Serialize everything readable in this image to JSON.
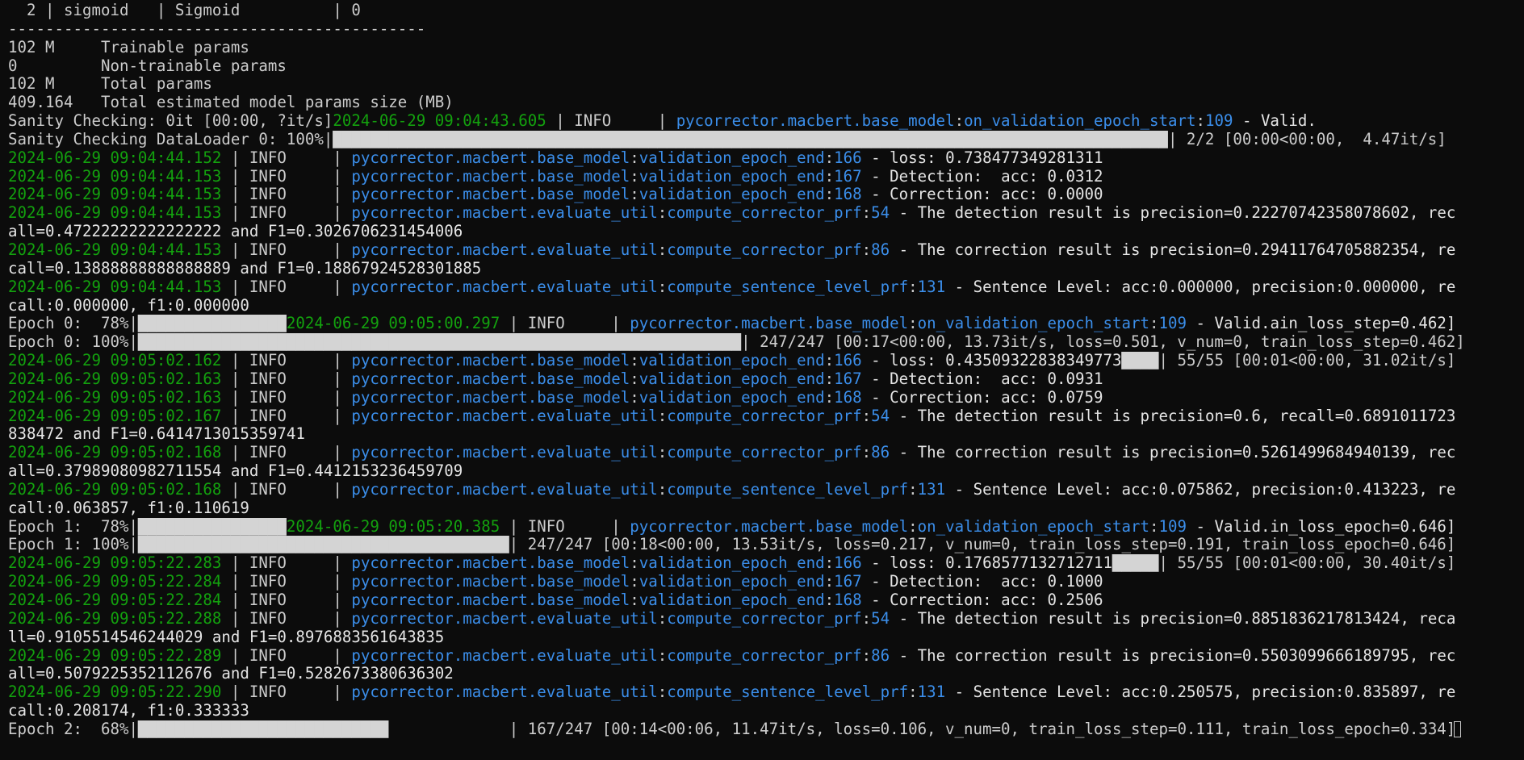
{
  "window": {
    "app": "terminal",
    "colors": {
      "background": "#0c0c0c",
      "text": "#cccccc",
      "timestamp": "#13a10e",
      "module_path": "#3b8eea"
    }
  },
  "lines": [
    [
      {
        "t": "  2 | sigmoid   | Sigmoid          | 0",
        "c": "default"
      }
    ],
    [
      {
        "t": "---------------------------------------------",
        "c": "default"
      }
    ],
    [
      {
        "t": "102 M     Trainable params",
        "c": "default"
      }
    ],
    [
      {
        "t": "0         Non-trainable params",
        "c": "default"
      }
    ],
    [
      {
        "t": "102 M     Total params",
        "c": "default"
      }
    ],
    [
      {
        "t": "409.164   Total estimated model params size (MB)",
        "c": "default"
      }
    ],
    [
      {
        "t": "Sanity Checking: 0it [00:00, ?it/s]",
        "c": "default"
      },
      {
        "t": "2024-06-29 09:04:43.605",
        "c": "green"
      },
      {
        "t": " | INFO     | ",
        "c": "default"
      },
      {
        "t": "pycorrector.macbert.base_model",
        "c": "blue"
      },
      {
        "t": ":",
        "c": "default"
      },
      {
        "t": "on_validation_epoch_start",
        "c": "blue"
      },
      {
        "t": ":",
        "c": "default"
      },
      {
        "t": "109",
        "c": "blue"
      },
      {
        "t": " - Valid.",
        "c": "white"
      }
    ],
    [
      {
        "t": "Sanity Checking DataLoader 0: 100%|",
        "c": "default"
      },
      {
        "t": "██████████████████████████████████████████████████████████████████████████████████████████",
        "c": "bar"
      },
      {
        "t": "| 2/2 [00:00<00:00,  4.47it/s]",
        "c": "default"
      }
    ],
    [
      {
        "t": "2024-06-29 09:04:44.152",
        "c": "green"
      },
      {
        "t": " | INFO     | ",
        "c": "default"
      },
      {
        "t": "pycorrector.macbert.base_model",
        "c": "blue"
      },
      {
        "t": ":",
        "c": "default"
      },
      {
        "t": "validation_epoch_end",
        "c": "blue"
      },
      {
        "t": ":",
        "c": "default"
      },
      {
        "t": "166",
        "c": "blue"
      },
      {
        "t": " - loss: 0.738477349281311",
        "c": "white"
      }
    ],
    [
      {
        "t": "2024-06-29 09:04:44.153",
        "c": "green"
      },
      {
        "t": " | INFO     | ",
        "c": "default"
      },
      {
        "t": "pycorrector.macbert.base_model",
        "c": "blue"
      },
      {
        "t": ":",
        "c": "default"
      },
      {
        "t": "validation_epoch_end",
        "c": "blue"
      },
      {
        "t": ":",
        "c": "default"
      },
      {
        "t": "167",
        "c": "blue"
      },
      {
        "t": " - Detection:  acc: 0.0312",
        "c": "white"
      }
    ],
    [
      {
        "t": "2024-06-29 09:04:44.153",
        "c": "green"
      },
      {
        "t": " | INFO     | ",
        "c": "default"
      },
      {
        "t": "pycorrector.macbert.base_model",
        "c": "blue"
      },
      {
        "t": ":",
        "c": "default"
      },
      {
        "t": "validation_epoch_end",
        "c": "blue"
      },
      {
        "t": ":",
        "c": "default"
      },
      {
        "t": "168",
        "c": "blue"
      },
      {
        "t": " - Correction: acc: 0.0000",
        "c": "white"
      }
    ],
    [
      {
        "t": "2024-06-29 09:04:44.153",
        "c": "green"
      },
      {
        "t": " | INFO     | ",
        "c": "default"
      },
      {
        "t": "pycorrector.macbert.evaluate_util",
        "c": "blue"
      },
      {
        "t": ":",
        "c": "default"
      },
      {
        "t": "compute_corrector_prf",
        "c": "blue"
      },
      {
        "t": ":",
        "c": "default"
      },
      {
        "t": "54",
        "c": "blue"
      },
      {
        "t": " - The detection result is precision=0.22270742358078602, rec",
        "c": "white"
      }
    ],
    [
      {
        "t": "all=0.47222222222222222 and F1=0.3026706231454006",
        "c": "white"
      }
    ],
    [
      {
        "t": "2024-06-29 09:04:44.153",
        "c": "green"
      },
      {
        "t": " | INFO     | ",
        "c": "default"
      },
      {
        "t": "pycorrector.macbert.evaluate_util",
        "c": "blue"
      },
      {
        "t": ":",
        "c": "default"
      },
      {
        "t": "compute_corrector_prf",
        "c": "blue"
      },
      {
        "t": ":",
        "c": "default"
      },
      {
        "t": "86",
        "c": "blue"
      },
      {
        "t": " - The correction result is precision=0.29411764705882354, re",
        "c": "white"
      }
    ],
    [
      {
        "t": "call=0.13888888888888889 and F1=0.18867924528301885",
        "c": "white"
      }
    ],
    [
      {
        "t": "2024-06-29 09:04:44.153",
        "c": "green"
      },
      {
        "t": " | INFO     | ",
        "c": "default"
      },
      {
        "t": "pycorrector.macbert.evaluate_util",
        "c": "blue"
      },
      {
        "t": ":",
        "c": "default"
      },
      {
        "t": "compute_sentence_level_prf",
        "c": "blue"
      },
      {
        "t": ":",
        "c": "default"
      },
      {
        "t": "131",
        "c": "blue"
      },
      {
        "t": " - Sentence Level: acc:0.000000, precision:0.000000, re",
        "c": "white"
      }
    ],
    [
      {
        "t": "call:0.000000, f1:0.000000",
        "c": "white"
      }
    ],
    [
      {
        "t": "Epoch 0:  78%|",
        "c": "default"
      },
      {
        "t": "████████████████",
        "c": "bar"
      },
      {
        "t": "2024-06-29 09:05:00.297",
        "c": "green"
      },
      {
        "t": " | INFO     | ",
        "c": "default"
      },
      {
        "t": "pycorrector.macbert.base_model",
        "c": "blue"
      },
      {
        "t": ":",
        "c": "default"
      },
      {
        "t": "on_validation_epoch_start",
        "c": "blue"
      },
      {
        "t": ":",
        "c": "default"
      },
      {
        "t": "109",
        "c": "blue"
      },
      {
        "t": " - Valid.ain_loss_step=0.462]",
        "c": "white"
      }
    ],
    [
      {
        "t": "Epoch 0: 100%|",
        "c": "default"
      },
      {
        "t": "█████████████████████████████████████████████████████████████████",
        "c": "bar"
      },
      {
        "t": "| 247/247 [00:17<00:00, 13.73it/s, loss=0.501, v_num=0, train_loss_step=0.462]",
        "c": "default"
      }
    ],
    [
      {
        "t": "2024-06-29 09:05:02.162",
        "c": "green"
      },
      {
        "t": " | INFO     | ",
        "c": "default"
      },
      {
        "t": "pycorrector.macbert.base_model",
        "c": "blue"
      },
      {
        "t": ":",
        "c": "default"
      },
      {
        "t": "validation_epoch_end",
        "c": "blue"
      },
      {
        "t": ":",
        "c": "default"
      },
      {
        "t": "166",
        "c": "blue"
      },
      {
        "t": " - loss: 0.43509322838349773",
        "c": "white"
      },
      {
        "t": "████",
        "c": "bar"
      },
      {
        "t": "| 55/55 [00:01<00:00, 31.02it/s]",
        "c": "default"
      }
    ],
    [
      {
        "t": "2024-06-29 09:05:02.163",
        "c": "green"
      },
      {
        "t": " | INFO     | ",
        "c": "default"
      },
      {
        "t": "pycorrector.macbert.base_model",
        "c": "blue"
      },
      {
        "t": ":",
        "c": "default"
      },
      {
        "t": "validation_epoch_end",
        "c": "blue"
      },
      {
        "t": ":",
        "c": "default"
      },
      {
        "t": "167",
        "c": "blue"
      },
      {
        "t": " - Detection:  acc: 0.0931",
        "c": "white"
      }
    ],
    [
      {
        "t": "2024-06-29 09:05:02.163",
        "c": "green"
      },
      {
        "t": " | INFO     | ",
        "c": "default"
      },
      {
        "t": "pycorrector.macbert.base_model",
        "c": "blue"
      },
      {
        "t": ":",
        "c": "default"
      },
      {
        "t": "validation_epoch_end",
        "c": "blue"
      },
      {
        "t": ":",
        "c": "default"
      },
      {
        "t": "168",
        "c": "blue"
      },
      {
        "t": " - Correction: acc: 0.0759",
        "c": "white"
      }
    ],
    [
      {
        "t": "2024-06-29 09:05:02.167",
        "c": "green"
      },
      {
        "t": " | INFO     | ",
        "c": "default"
      },
      {
        "t": "pycorrector.macbert.evaluate_util",
        "c": "blue"
      },
      {
        "t": ":",
        "c": "default"
      },
      {
        "t": "compute_corrector_prf",
        "c": "blue"
      },
      {
        "t": ":",
        "c": "default"
      },
      {
        "t": "54",
        "c": "blue"
      },
      {
        "t": " - The detection result is precision=0.6, recall=0.6891011723",
        "c": "white"
      }
    ],
    [
      {
        "t": "838472 and F1=0.6414713015359741",
        "c": "white"
      }
    ],
    [
      {
        "t": "2024-06-29 09:05:02.168",
        "c": "green"
      },
      {
        "t": " | INFO     | ",
        "c": "default"
      },
      {
        "t": "pycorrector.macbert.evaluate_util",
        "c": "blue"
      },
      {
        "t": ":",
        "c": "default"
      },
      {
        "t": "compute_corrector_prf",
        "c": "blue"
      },
      {
        "t": ":",
        "c": "default"
      },
      {
        "t": "86",
        "c": "blue"
      },
      {
        "t": " - The correction result is precision=0.5261499684940139, rec",
        "c": "white"
      }
    ],
    [
      {
        "t": "all=0.37989080982711554 and F1=0.4412153236459709",
        "c": "white"
      }
    ],
    [
      {
        "t": "2024-06-29 09:05:02.168",
        "c": "green"
      },
      {
        "t": " | INFO     | ",
        "c": "default"
      },
      {
        "t": "pycorrector.macbert.evaluate_util",
        "c": "blue"
      },
      {
        "t": ":",
        "c": "default"
      },
      {
        "t": "compute_sentence_level_prf",
        "c": "blue"
      },
      {
        "t": ":",
        "c": "default"
      },
      {
        "t": "131",
        "c": "blue"
      },
      {
        "t": " - Sentence Level: acc:0.075862, precision:0.413223, re",
        "c": "white"
      }
    ],
    [
      {
        "t": "call:0.063857, f1:0.110619",
        "c": "white"
      }
    ],
    [
      {
        "t": "Epoch 1:  78%|",
        "c": "default"
      },
      {
        "t": "████████████████",
        "c": "bar"
      },
      {
        "t": "2024-06-29 09:05:20.385",
        "c": "green"
      },
      {
        "t": " | INFO     | ",
        "c": "default"
      },
      {
        "t": "pycorrector.macbert.base_model",
        "c": "blue"
      },
      {
        "t": ":",
        "c": "default"
      },
      {
        "t": "on_validation_epoch_start",
        "c": "blue"
      },
      {
        "t": ":",
        "c": "default"
      },
      {
        "t": "109",
        "c": "blue"
      },
      {
        "t": " - Valid.in_loss_epoch=0.646]",
        "c": "white"
      }
    ],
    [
      {
        "t": "Epoch 1: 100%|",
        "c": "default"
      },
      {
        "t": "████████████████████████████████████████",
        "c": "bar"
      },
      {
        "t": "| 247/247 [00:18<00:00, 13.53it/s, loss=0.217, v_num=0, train_loss_step=0.191, train_loss_epoch=0.646]",
        "c": "default"
      }
    ],
    [
      {
        "t": "2024-06-29 09:05:22.283",
        "c": "green"
      },
      {
        "t": " | INFO     | ",
        "c": "default"
      },
      {
        "t": "pycorrector.macbert.base_model",
        "c": "blue"
      },
      {
        "t": ":",
        "c": "default"
      },
      {
        "t": "validation_epoch_end",
        "c": "blue"
      },
      {
        "t": ":",
        "c": "default"
      },
      {
        "t": "166",
        "c": "blue"
      },
      {
        "t": " - loss: 0.1768577132712711",
        "c": "white"
      },
      {
        "t": "█████",
        "c": "bar"
      },
      {
        "t": "| 55/55 [00:01<00:00, 30.40it/s]",
        "c": "default"
      }
    ],
    [
      {
        "t": "2024-06-29 09:05:22.284",
        "c": "green"
      },
      {
        "t": " | INFO     | ",
        "c": "default"
      },
      {
        "t": "pycorrector.macbert.base_model",
        "c": "blue"
      },
      {
        "t": ":",
        "c": "default"
      },
      {
        "t": "validation_epoch_end",
        "c": "blue"
      },
      {
        "t": ":",
        "c": "default"
      },
      {
        "t": "167",
        "c": "blue"
      },
      {
        "t": " - Detection:  acc: 0.1000",
        "c": "white"
      }
    ],
    [
      {
        "t": "2024-06-29 09:05:22.284",
        "c": "green"
      },
      {
        "t": " | INFO     | ",
        "c": "default"
      },
      {
        "t": "pycorrector.macbert.base_model",
        "c": "blue"
      },
      {
        "t": ":",
        "c": "default"
      },
      {
        "t": "validation_epoch_end",
        "c": "blue"
      },
      {
        "t": ":",
        "c": "default"
      },
      {
        "t": "168",
        "c": "blue"
      },
      {
        "t": " - Correction: acc: 0.2506",
        "c": "white"
      }
    ],
    [
      {
        "t": "2024-06-29 09:05:22.288",
        "c": "green"
      },
      {
        "t": " | INFO     | ",
        "c": "default"
      },
      {
        "t": "pycorrector.macbert.evaluate_util",
        "c": "blue"
      },
      {
        "t": ":",
        "c": "default"
      },
      {
        "t": "compute_corrector_prf",
        "c": "blue"
      },
      {
        "t": ":",
        "c": "default"
      },
      {
        "t": "54",
        "c": "blue"
      },
      {
        "t": " - The detection result is precision=0.8851836217813424, reca",
        "c": "white"
      }
    ],
    [
      {
        "t": "ll=0.9105514546244029 and F1=0.8976883561643835",
        "c": "white"
      }
    ],
    [
      {
        "t": "2024-06-29 09:05:22.289",
        "c": "green"
      },
      {
        "t": " | INFO     | ",
        "c": "default"
      },
      {
        "t": "pycorrector.macbert.evaluate_util",
        "c": "blue"
      },
      {
        "t": ":",
        "c": "default"
      },
      {
        "t": "compute_corrector_prf",
        "c": "blue"
      },
      {
        "t": ":",
        "c": "default"
      },
      {
        "t": "86",
        "c": "blue"
      },
      {
        "t": " - The correction result is precision=0.5503099666189795, rec",
        "c": "white"
      }
    ],
    [
      {
        "t": "all=0.5079225352112676 and F1=0.5282673380636302",
        "c": "white"
      }
    ],
    [
      {
        "t": "2024-06-29 09:05:22.290",
        "c": "green"
      },
      {
        "t": " | INFO     | ",
        "c": "default"
      },
      {
        "t": "pycorrector.macbert.evaluate_util",
        "c": "blue"
      },
      {
        "t": ":",
        "c": "default"
      },
      {
        "t": "compute_sentence_level_prf",
        "c": "blue"
      },
      {
        "t": ":",
        "c": "default"
      },
      {
        "t": "131",
        "c": "blue"
      },
      {
        "t": " - Sentence Level: acc:0.250575, precision:0.835897, re",
        "c": "white"
      }
    ],
    [
      {
        "t": "call:0.208174, f1:0.333333",
        "c": "white"
      }
    ],
    [
      {
        "t": "Epoch 2:  68%|",
        "c": "default"
      },
      {
        "t": "███████████████████████████",
        "c": "bar"
      },
      {
        "t": "             | 167/247 [00:14<00:06, 11.47it/s, loss=0.106, v_num=0, train_loss_step=0.111, train_loss_epoch=0.334]",
        "c": "default"
      }
    ]
  ]
}
